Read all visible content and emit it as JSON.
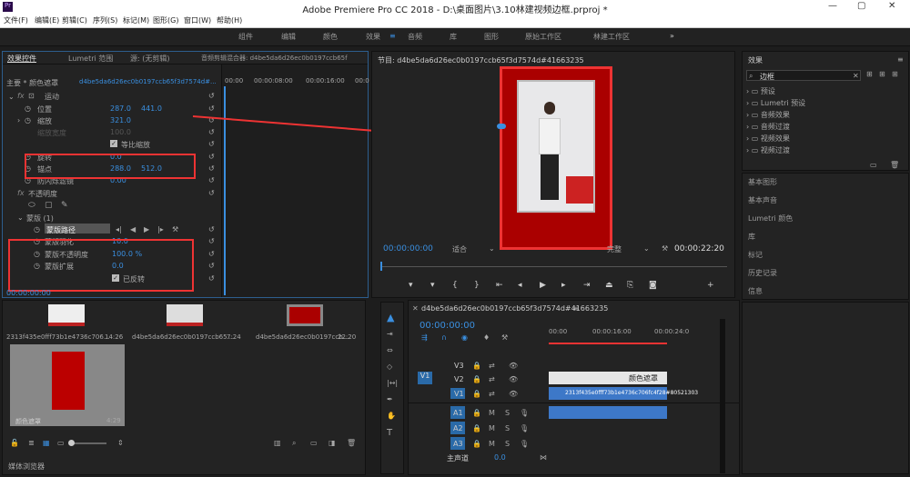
{
  "app": {
    "title": "Adobe Premiere Pro CC 2018 - D:\\桌面图片\\3.10林建视频边框.prproj *"
  },
  "menu": [
    "文件(F)",
    "编辑(E)",
    "剪辑(C)",
    "序列(S)",
    "标记(M)",
    "图形(G)",
    "窗口(W)",
    "帮助(H)"
  ],
  "workspaces": [
    "组件",
    "编辑",
    "颜色",
    "效果",
    "音频",
    "库",
    "图形",
    "原始工作区",
    "林建工作区"
  ],
  "effect_controls": {
    "tabs": [
      "效果控件",
      "Lumetri 范围",
      "源: (无剪辑)",
      "音频剪辑混合器: d4be5da6d26ec0b0197ccb65f"
    ],
    "clip": "主要 * 颜色遮罩",
    "seq": "d4be5da6d26ec0b0197ccb65f3d7574d#...",
    "tc": [
      "00:00",
      "00:00:08:00",
      "00:00:16:00",
      "00:0"
    ],
    "motion": "运动",
    "pos_label": "位置",
    "pos_x": "287.0",
    "pos_y": "441.0",
    "scale_label": "缩放",
    "scale_val": "321.0",
    "scale_w_label": "缩放宽度",
    "scale_w_val": "100.0",
    "uniform": "等比缩放",
    "rot_label": "旋转",
    "rot_val": "0.0",
    "anchor_label": "锚点",
    "anchor_x": "288.0",
    "anchor_y": "512.0",
    "flicker_label": "防闪烁滤镜",
    "flicker_val": "0.00",
    "opacity": "不透明度",
    "mask": "蒙版 (1)",
    "mask_path": "蒙版路径",
    "feather_label": "蒙版羽化",
    "feather_val": "10.0",
    "mask_op_label": "蒙版不透明度",
    "mask_op_val": "100.0 %",
    "expand_label": "蒙版扩展",
    "expand_val": "0.0",
    "inverted": "已反转",
    "timecode": "00:00:00:00"
  },
  "program": {
    "title": "节目: d4be5da6d26ec0b0197ccb65f3d7574d#41663235",
    "tc_left": "00:00:00:00",
    "fit": "适合",
    "quality": "完整",
    "tc_right": "00:00:22:20"
  },
  "effects": {
    "title": "效果",
    "search": "边框",
    "tree": [
      "预设",
      "Lumetri 预设",
      "音频效果",
      "音频过渡",
      "视频效果",
      "视频过渡"
    ],
    "panels": [
      "基本图形",
      "基本声音",
      "Lumetri 颜色",
      "库",
      "标记",
      "历史记录",
      "信息"
    ]
  },
  "project": {
    "items": [
      {
        "name": "2313f435e0fff73b1e4736c706...",
        "dur": "14:26"
      },
      {
        "name": "d4be5da6d26ec0b0197ccb65...",
        "dur": "7:24"
      },
      {
        "name": "d4be5da6d26ec0b0197ccb...",
        "dur": "22:20"
      },
      {
        "name": "颜色遮罩",
        "dur": "4:29"
      }
    ],
    "footer": "媒体浏览器"
  },
  "timeline": {
    "title": "d4be5da6d26ec0b0197ccb65f3d7574d#41663235",
    "tc": "00:00:00:00",
    "ruler": [
      "00:00",
      "00:00:16:00",
      "00:00:24:0"
    ],
    "tracks": [
      "V3",
      "V2",
      "V1",
      "A1",
      "A2",
      "A3"
    ],
    "master": "主声道",
    "master_val": "0.0",
    "clip_color": "颜色遮罩",
    "clip_v1": "2313f435e0fff73b1e4736c706fc4f28#80521303"
  },
  "colors": {
    "accent": "#3a8fe0",
    "red": "#e33333",
    "bg": "#232323"
  }
}
